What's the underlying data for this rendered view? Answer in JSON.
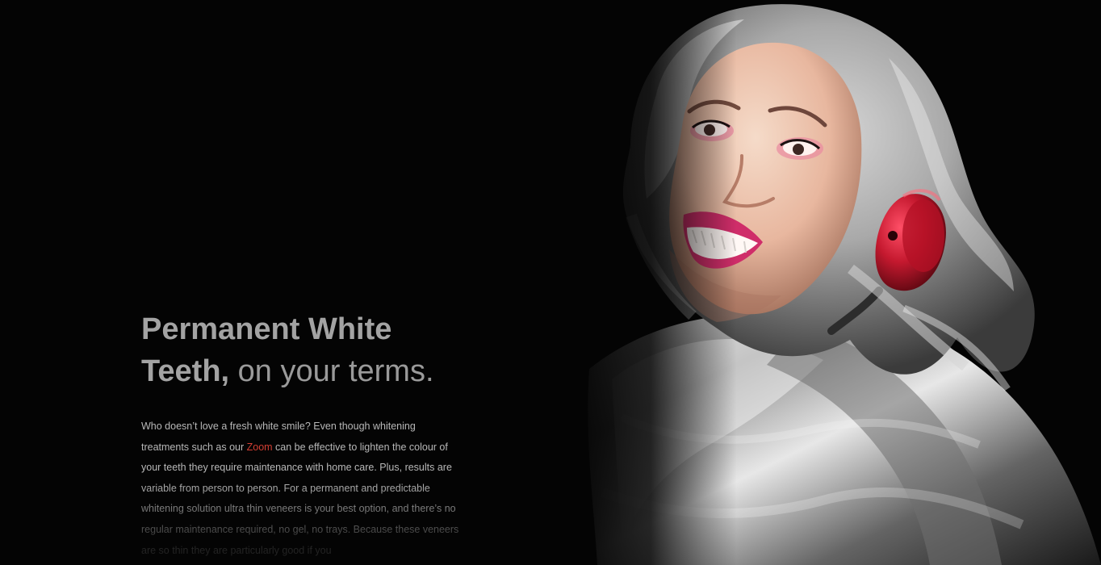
{
  "hero": {
    "headline_bold": "Permanent White Teeth,",
    "headline_rest": " on your terms.",
    "paragraph_part_1": "Who doesn’t love a fresh white smile? Even though whitening treatments such as our ",
    "zoom_link": "Zoom",
    "paragraph_part_2": " can be effective to lighten the colour of your teeth they require maintenance with home care. Plus, results are variable from person to person. For a permanent and predictable whitening solution ultra thin veneers is your best option, and there’s no regular maintenance required, no gel, no trays. Because these veneers are so thin they are particularly good if you"
  },
  "image": {
    "subject": "smiling woman with silver hair, red headphones and silver puffer jacket"
  },
  "colors": {
    "background": "#040404",
    "headline": "#a3a3a3",
    "body_text": "#b8b8b8",
    "link": "#d43f33",
    "headphone_red": "#c5192f",
    "jacket_silver": "#b9b9b9"
  }
}
